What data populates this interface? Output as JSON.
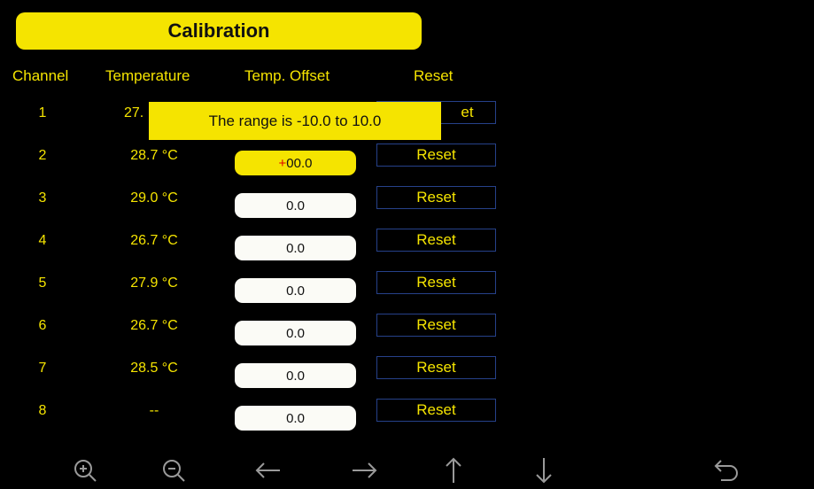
{
  "title": "Calibration",
  "headers": {
    "channel": "Channel",
    "temperature": "Temperature",
    "offset": "Temp. Offset",
    "reset": "Reset"
  },
  "tooltip": "The range is -10.0 to 10.0",
  "rows": [
    {
      "channel": "1",
      "temperature": "27.",
      "offset": "",
      "reset": "et"
    },
    {
      "channel": "2",
      "temperature": "28.7 °C",
      "offset_sign": "+",
      "offset": "00.0",
      "reset": "Reset"
    },
    {
      "channel": "3",
      "temperature": "29.0 °C",
      "offset": "0.0",
      "reset": "Reset"
    },
    {
      "channel": "4",
      "temperature": "26.7 °C",
      "offset": "0.0",
      "reset": "Reset"
    },
    {
      "channel": "5",
      "temperature": "27.9 °C",
      "offset": "0.0",
      "reset": "Reset"
    },
    {
      "channel": "6",
      "temperature": "26.7 °C",
      "offset": "0.0",
      "reset": "Reset"
    },
    {
      "channel": "7",
      "temperature": "28.5 °C",
      "offset": "0.0",
      "reset": "Reset"
    },
    {
      "channel": "8",
      "temperature": "--",
      "offset": "0.0",
      "reset": "Reset"
    }
  ],
  "toolbar": {
    "icons": [
      "zoom-in-icon",
      "zoom-out-icon",
      "arrow-left-icon",
      "arrow-right-icon",
      "arrow-up-icon",
      "arrow-down-icon",
      "back-icon"
    ]
  },
  "colors": {
    "accent": "#f5e400",
    "background": "#000000",
    "reset_border": "#26418a",
    "sign": "#e00000"
  }
}
